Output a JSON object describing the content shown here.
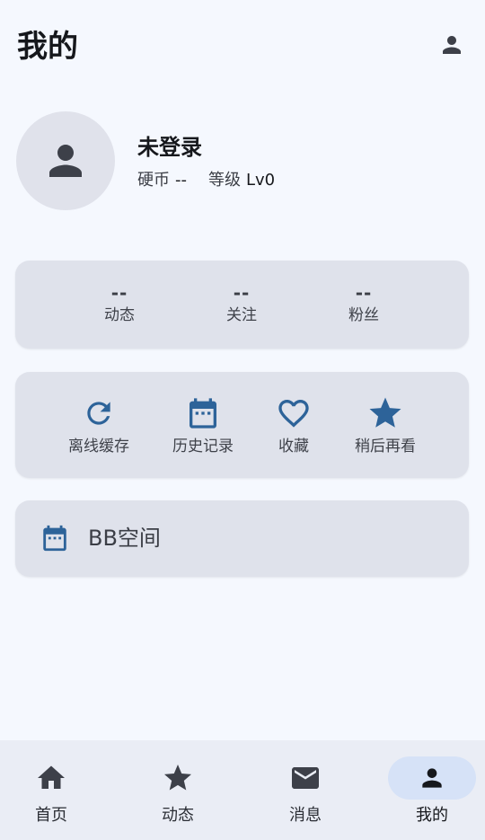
{
  "header": {
    "title": "我的",
    "user_icon": "person-icon"
  },
  "profile": {
    "name": "未登录",
    "coin_label": "硬币",
    "coin_value": "--",
    "level_label": "等级",
    "level_value": "Lv0",
    "avatar_icon": "person-icon"
  },
  "stats": [
    {
      "value": "--",
      "label": "动态"
    },
    {
      "value": "--",
      "label": "关注"
    },
    {
      "value": "--",
      "label": "粉丝"
    }
  ],
  "actions": [
    {
      "label": "离线缓存",
      "icon": "refresh-icon"
    },
    {
      "label": "历史记录",
      "icon": "calendar-icon"
    },
    {
      "label": "收藏",
      "icon": "heart-icon"
    },
    {
      "label": "稍后再看",
      "icon": "star-icon"
    }
  ],
  "space": {
    "label": "BB空间",
    "icon": "calendar-icon"
  },
  "bottom_nav": [
    {
      "label": "首页",
      "icon": "home-icon"
    },
    {
      "label": "动态",
      "icon": "star-icon"
    },
    {
      "label": "消息",
      "icon": "mail-icon"
    },
    {
      "label": "我的",
      "icon": "person-icon",
      "active": true
    }
  ],
  "colors": {
    "background": "#f5f8fe",
    "card": "#dfe2eb",
    "accent_blue": "#2d6399",
    "nav_active_pill": "#d6e2f7",
    "text_dark": "#16181c"
  }
}
